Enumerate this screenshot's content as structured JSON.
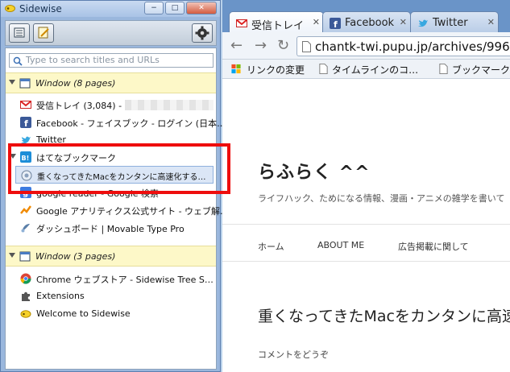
{
  "sidewise": {
    "title": "Sidewise",
    "window_buttons": [
      "−",
      "□",
      "✕"
    ],
    "search_placeholder": "Type to search titles and URLs",
    "windows": [
      {
        "label": "Window (8 pages)",
        "tabs": [
          {
            "label": "受信トレイ (3,084) -",
            "icon": "gmail-icon",
            "redacted": true
          },
          {
            "label": "Facebook - フェイスブック - ログイン (日本…",
            "icon": "facebook-icon"
          },
          {
            "label": "Twitter",
            "icon": "twitter-icon"
          },
          {
            "label": "はてなブックマーク",
            "icon": "hatena-icon"
          },
          {
            "label": "重くなってきたMacをカンタンに高速化する…",
            "icon": "page-icon",
            "child": true,
            "selected": true
          },
          {
            "label": "google reader - Google 検索",
            "icon": "google-icon"
          },
          {
            "label": "Google アナリティクス公式サイト - ウェブ解…",
            "icon": "analytics-icon"
          },
          {
            "label": "ダッシュボード | Movable Type Pro",
            "icon": "movabletype-icon"
          }
        ]
      },
      {
        "label": "Window (3 pages)",
        "tabs": [
          {
            "label": "Chrome ウェブストア - Sidewise Tree S…",
            "icon": "chrome-store-icon"
          },
          {
            "label": "Extensions",
            "icon": "puzzle-icon"
          },
          {
            "label": "Welcome to Sidewise",
            "icon": "sidewise-icon"
          }
        ]
      }
    ]
  },
  "chrome": {
    "tabs": [
      {
        "label": "受信トレイ",
        "icon": "gmail-icon"
      },
      {
        "label": "Facebook",
        "icon": "facebook-icon"
      },
      {
        "label": "Twitter",
        "icon": "twitter-icon"
      }
    ],
    "url": "chantk-twi.pupu.jp/archives/996",
    "bookmarks": [
      "リンクの変更",
      "タイムラインのコ…",
      "ブックマーク"
    ],
    "page": {
      "site_title": "らふらく ^^",
      "tagline": "ライフハック、ためになる情報、漫画・アニメの雑学を書いて",
      "menu": [
        "ホーム",
        "ABOUT ME",
        "広告掲載に関して"
      ],
      "post_title": "重くなってきたMacをカンタンに高速",
      "comment": "コメントをどうぞ"
    }
  },
  "colors": {
    "highlight_border": "#ee0d0d",
    "window_row": "#fdf8c8",
    "selected_row": "#dbe6f6"
  }
}
